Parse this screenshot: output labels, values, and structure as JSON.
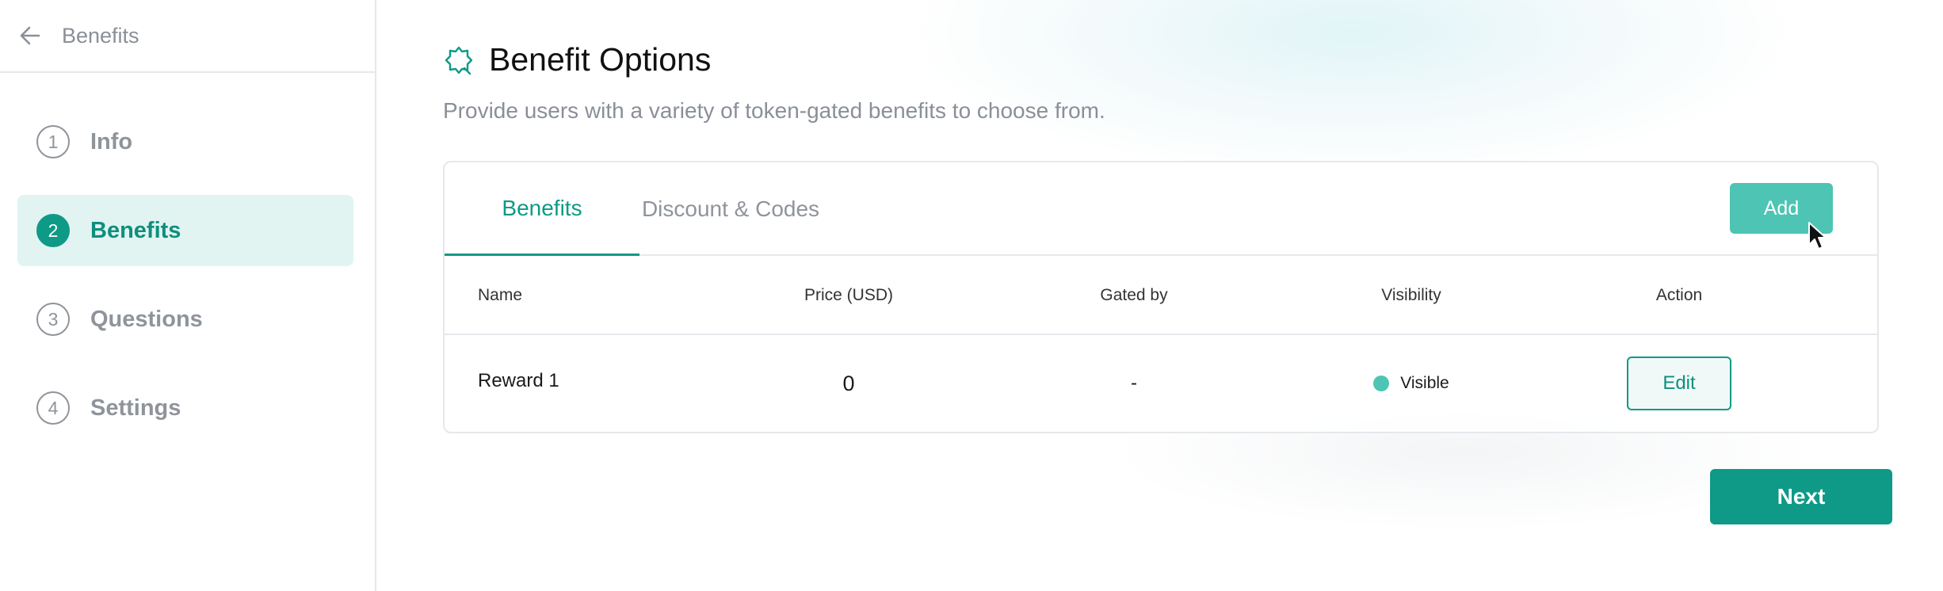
{
  "sidebar": {
    "back_icon": "arrow-left-icon",
    "title": "Benefits",
    "steps": [
      {
        "number": "1",
        "label": "Info",
        "active": false
      },
      {
        "number": "2",
        "label": "Benefits",
        "active": true
      },
      {
        "number": "3",
        "label": "Questions",
        "active": false
      },
      {
        "number": "4",
        "label": "Settings",
        "active": false
      }
    ]
  },
  "main": {
    "title_icon": "badge-icon",
    "title": "Benefit Options",
    "subtitle": "Provide users with a variety of token-gated benefits to choose from.",
    "tabs": [
      {
        "label": "Benefits",
        "active": true
      },
      {
        "label": "Discount & Codes",
        "active": false
      }
    ],
    "add_label": "Add",
    "table": {
      "columns": [
        "Name",
        "Price (USD)",
        "Gated by",
        "Visibility",
        "Action"
      ],
      "rows": [
        {
          "name": "Reward 1",
          "price": "0",
          "gated_by": "-",
          "visibility": "Visible",
          "action": "Edit"
        }
      ]
    },
    "next_label": "Next"
  },
  "colors": {
    "accent": "#0e9a87",
    "accent_light": "#4dc4b4",
    "active_bg": "#e1f4f1",
    "muted_text": "#8f949b"
  }
}
